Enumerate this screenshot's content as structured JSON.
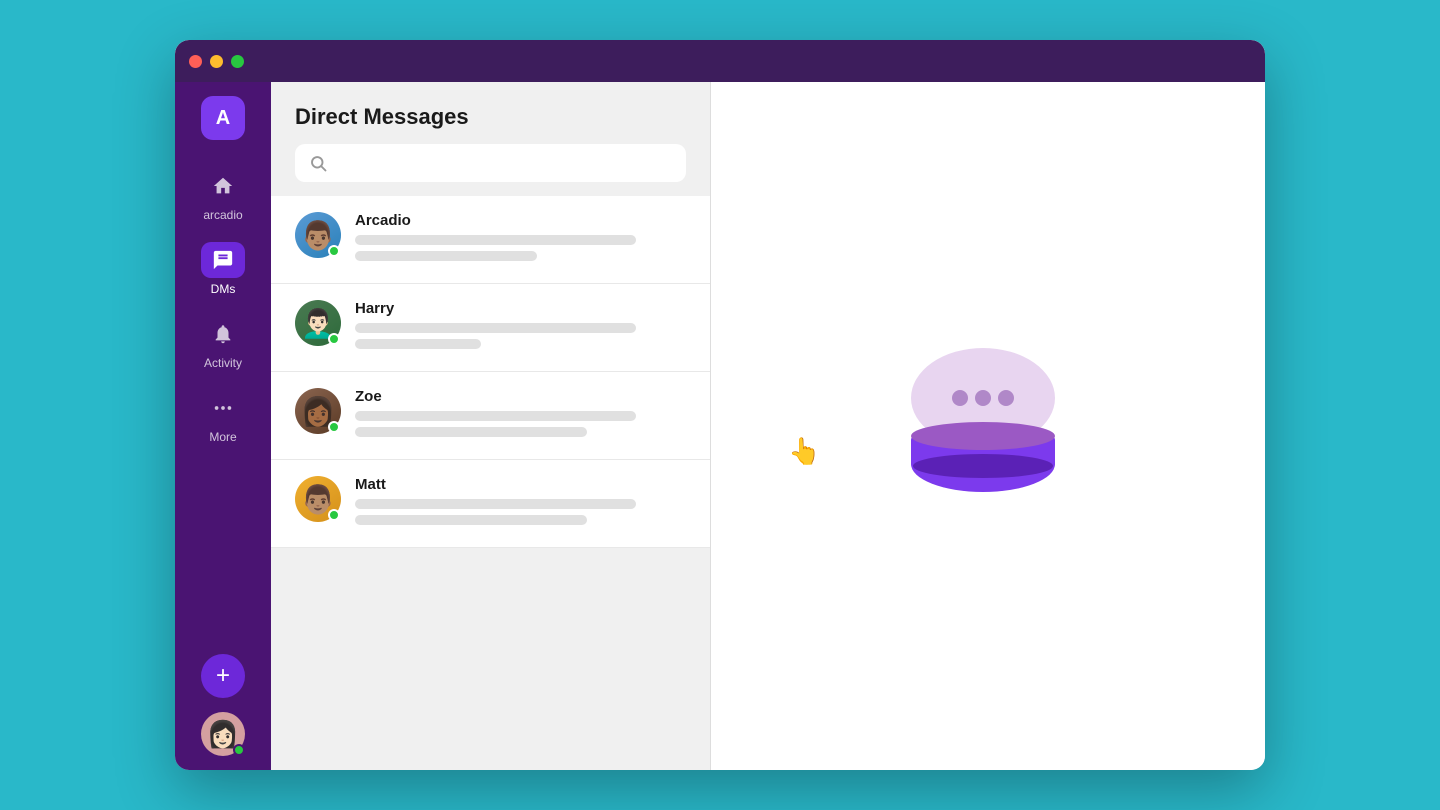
{
  "window": {
    "title": "Direct Messages"
  },
  "sidebar": {
    "user_initial": "A",
    "items": [
      {
        "id": "home",
        "label": "Home",
        "icon": "home"
      },
      {
        "id": "dms",
        "label": "DMs",
        "icon": "dms",
        "active": true
      },
      {
        "id": "activity",
        "label": "Activity",
        "icon": "bell"
      },
      {
        "id": "more",
        "label": "More",
        "icon": "more"
      }
    ],
    "new_button_label": "+",
    "bottom_avatar_emoji": "👩"
  },
  "dm_panel": {
    "title": "Direct messages",
    "search_placeholder": "",
    "contacts": [
      {
        "id": "arcadio",
        "name": "Arcadio",
        "emoji": "👨🏽",
        "online": true,
        "preview_lines": [
          "long",
          "short"
        ]
      },
      {
        "id": "harry",
        "name": "Harry",
        "emoji": "👨🏻‍🦱",
        "online": true,
        "preview_lines": [
          "long",
          "xshort"
        ]
      },
      {
        "id": "zoe",
        "name": "Zoe",
        "emoji": "👩🏾",
        "online": true,
        "preview_lines": [
          "long",
          "med"
        ]
      },
      {
        "id": "matt",
        "name": "Matt",
        "emoji": "👨🏽‍🦱",
        "online": true,
        "preview_lines": [
          "long",
          "med"
        ]
      }
    ]
  },
  "main": {
    "empty_state": true
  },
  "colors": {
    "sidebar_bg": "#4a1472",
    "active_item": "#6d28d9",
    "accent": "#7c3aed",
    "online": "#28c840",
    "bubble_light": "#e8d5f0",
    "bubble_dark": "#7c3aed"
  }
}
